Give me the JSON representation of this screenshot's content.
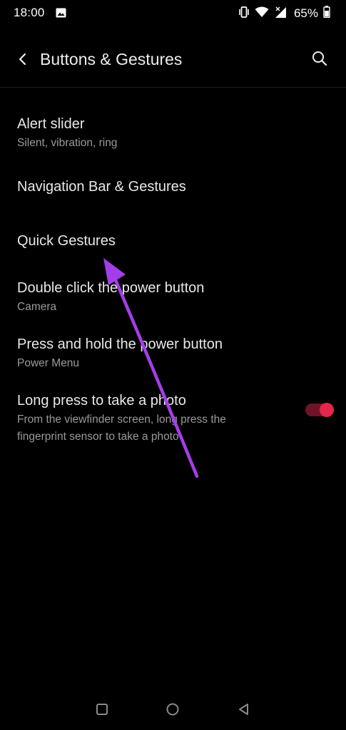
{
  "status_bar": {
    "time": "18:00",
    "battery_percent": "65%",
    "icons": [
      "gallery-icon",
      "vibrate-icon",
      "wifi-icon",
      "signal-icon",
      "battery-icon"
    ]
  },
  "header": {
    "title": "Buttons & Gestures",
    "back_icon": "chevron-left-icon",
    "search_icon": "search-icon"
  },
  "settings": {
    "items": [
      {
        "title": "Alert slider",
        "summary": "Silent, vibration, ring"
      },
      {
        "title": "Navigation Bar & Gestures",
        "summary": ""
      },
      {
        "title": "Quick Gestures",
        "summary": ""
      },
      {
        "title": "Double click the power button",
        "summary": "Camera"
      },
      {
        "title": "Press and hold the power button",
        "summary": "Power Menu"
      },
      {
        "title": "Long press to take a photo",
        "summary_line1": "From the viewfinder screen, long press the",
        "summary_line2": "fingerprint sensor to take a photo",
        "toggle_on": true
      }
    ]
  },
  "colors": {
    "background": "#000000",
    "accent": "#e3264a",
    "annotation": "#a43ee8"
  },
  "nav_bar": {
    "icons": [
      "recents-square-icon",
      "home-circle-icon",
      "back-triangle-icon"
    ]
  }
}
